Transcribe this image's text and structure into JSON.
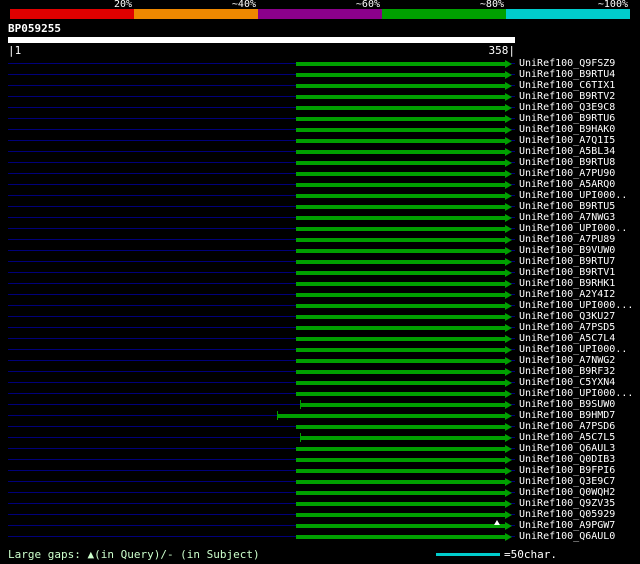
{
  "scale": {
    "labels": [
      "20%",
      "~40%",
      "~60%",
      "~80%",
      "~100%"
    ],
    "colors": [
      "#e00000",
      "#ee8800",
      "#8b008b",
      "#00a000",
      "#00cccc"
    ]
  },
  "query": {
    "name": "BP059255"
  },
  "ruler": {
    "left": "|1",
    "right": "358|"
  },
  "footer": {
    "legend": "Large gaps: ▲(in Query)/- (in Subject)",
    "scale_note": "=50char."
  },
  "colors": {
    "query_bar": "#ffffff",
    "baseline": "#00007a",
    "hit_bar": "#00a000",
    "scale_line": "#00cccc",
    "legend_text": "#ccffcc",
    "marker": "#ffffff"
  },
  "chart_data": {
    "type": "bar",
    "orientation": "horizontal",
    "x_axis": {
      "label": "query position",
      "range": [
        1,
        358
      ]
    },
    "query_name": "BP059255",
    "legend_buckets": [
      "20%",
      "~40%",
      "~60%",
      "~80%",
      "~100%"
    ],
    "hit_color_bucket": "~80%",
    "hits": [
      {
        "label": "UniRef100_Q9FSZ9",
        "from": 204,
        "to": 352
      },
      {
        "label": "UniRef100_B9RTU4",
        "from": 204,
        "to": 352
      },
      {
        "label": "UniRef100_C6TIX1",
        "from": 204,
        "to": 352
      },
      {
        "label": "UniRef100_B9RTV2",
        "from": 204,
        "to": 352
      },
      {
        "label": "UniRef100_Q3E9C8",
        "from": 204,
        "to": 352
      },
      {
        "label": "UniRef100_B9RTU6",
        "from": 204,
        "to": 352
      },
      {
        "label": "UniRef100_B9HAK0",
        "from": 204,
        "to": 352
      },
      {
        "label": "UniRef100_A7Q1I5",
        "from": 204,
        "to": 352
      },
      {
        "label": "UniRef100_A5BL34",
        "from": 204,
        "to": 352
      },
      {
        "label": "UniRef100_B9RTU8",
        "from": 204,
        "to": 352
      },
      {
        "label": "UniRef100_A7PU90",
        "from": 204,
        "to": 352
      },
      {
        "label": "UniRef100_A5ARQ0",
        "from": 204,
        "to": 352
      },
      {
        "label": "UniRef100_UPI000..",
        "from": 204,
        "to": 352
      },
      {
        "label": "UniRef100_B9RTU5",
        "from": 204,
        "to": 352
      },
      {
        "label": "UniRef100_A7NWG3",
        "from": 204,
        "to": 352
      },
      {
        "label": "UniRef100_UPI000..",
        "from": 204,
        "to": 352
      },
      {
        "label": "UniRef100_A7PU89",
        "from": 204,
        "to": 352
      },
      {
        "label": "UniRef100_B9VUW0",
        "from": 204,
        "to": 352
      },
      {
        "label": "UniRef100_B9RTU7",
        "from": 204,
        "to": 352
      },
      {
        "label": "UniRef100_B9RTV1",
        "from": 204,
        "to": 352
      },
      {
        "label": "UniRef100_B9RHK1",
        "from": 204,
        "to": 352
      },
      {
        "label": "UniRef100_A2Y4I2",
        "from": 204,
        "to": 352
      },
      {
        "label": "UniRef100_UPI000...",
        "from": 204,
        "to": 352
      },
      {
        "label": "UniRef100_Q3KU27",
        "from": 204,
        "to": 352
      },
      {
        "label": "UniRef100_A7PSD5",
        "from": 204,
        "to": 352
      },
      {
        "label": "UniRef100_A5C7L4",
        "from": 204,
        "to": 352
      },
      {
        "label": "UniRef100_UPI000..",
        "from": 204,
        "to": 352
      },
      {
        "label": "UniRef100_A7NWG2",
        "from": 204,
        "to": 352
      },
      {
        "label": "UniRef100_B9RF32",
        "from": 204,
        "to": 352
      },
      {
        "label": "UniRef100_C5YXN4",
        "from": 204,
        "to": 352
      },
      {
        "label": "UniRef100_UPI000...",
        "from": 204,
        "to": 352
      },
      {
        "label": "UniRef100_B9SUW0",
        "from": 207,
        "to": 352,
        "tick": true
      },
      {
        "label": "UniRef100_B9HMD7",
        "from": 191,
        "to": 352,
        "tick": true
      },
      {
        "label": "UniRef100_A7PSD6",
        "from": 204,
        "to": 352
      },
      {
        "label": "UniRef100_A5C7L5",
        "from": 207,
        "to": 352,
        "tick": true
      },
      {
        "label": "UniRef100_Q6AUL3",
        "from": 204,
        "to": 352
      },
      {
        "label": "UniRef100_Q0DIB3",
        "from": 204,
        "to": 352
      },
      {
        "label": "UniRef100_B9FPI6",
        "from": 204,
        "to": 352
      },
      {
        "label": "UniRef100_Q3E9C7",
        "from": 204,
        "to": 352
      },
      {
        "label": "UniRef100_Q0WQH2",
        "from": 204,
        "to": 352
      },
      {
        "label": "UniRef100_Q9ZV35",
        "from": 204,
        "to": 352
      },
      {
        "label": "UniRef100_Q05929",
        "from": 204,
        "to": 352
      },
      {
        "label": "UniRef100_A9PGW7",
        "from": 204,
        "to": 352,
        "gap_marker_at": 346
      },
      {
        "label": "UniRef100_Q6AUL0",
        "from": 204,
        "to": 352
      }
    ]
  }
}
